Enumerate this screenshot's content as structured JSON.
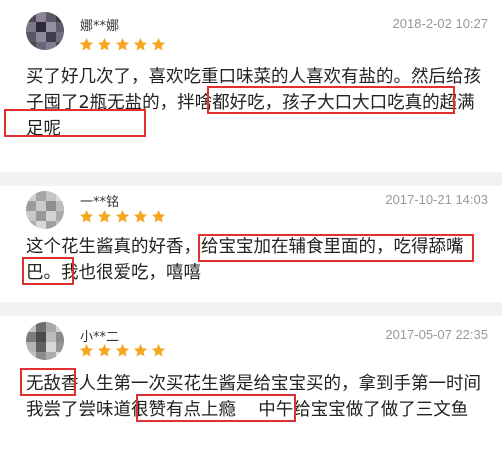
{
  "colors": {
    "highlight": "#e03030",
    "star": "#f5a623",
    "separator": "#f2f2f2",
    "date_text": "#999999"
  },
  "reviews": [
    {
      "user": "娜**娜",
      "date": "2018-2-02 10:27",
      "rating": 5,
      "text": "买了好几次了，喜欢吃重口味菜的人喜欢有盐的。然后给孩子囤了2瓶无盐的，拌啥都好吃，孩子大口大口吃真的超满足呢"
    },
    {
      "user": "一**铭",
      "date": "2017-10-21 14:03",
      "rating": 5,
      "text": "这个花生酱真的好香，给宝宝加在辅食里面的，吃得舔嘴巴。我也很爱吃，嘻嘻"
    },
    {
      "user": "小**二",
      "date": "2017-05-07 22:35",
      "rating": 5,
      "text": "无敌香人生第一次买花生酱是给宝宝买的，拿到手第一时间我尝了尝味道很赞有点上瘾    中午给宝宝做了做了三文鱼"
    }
  ]
}
